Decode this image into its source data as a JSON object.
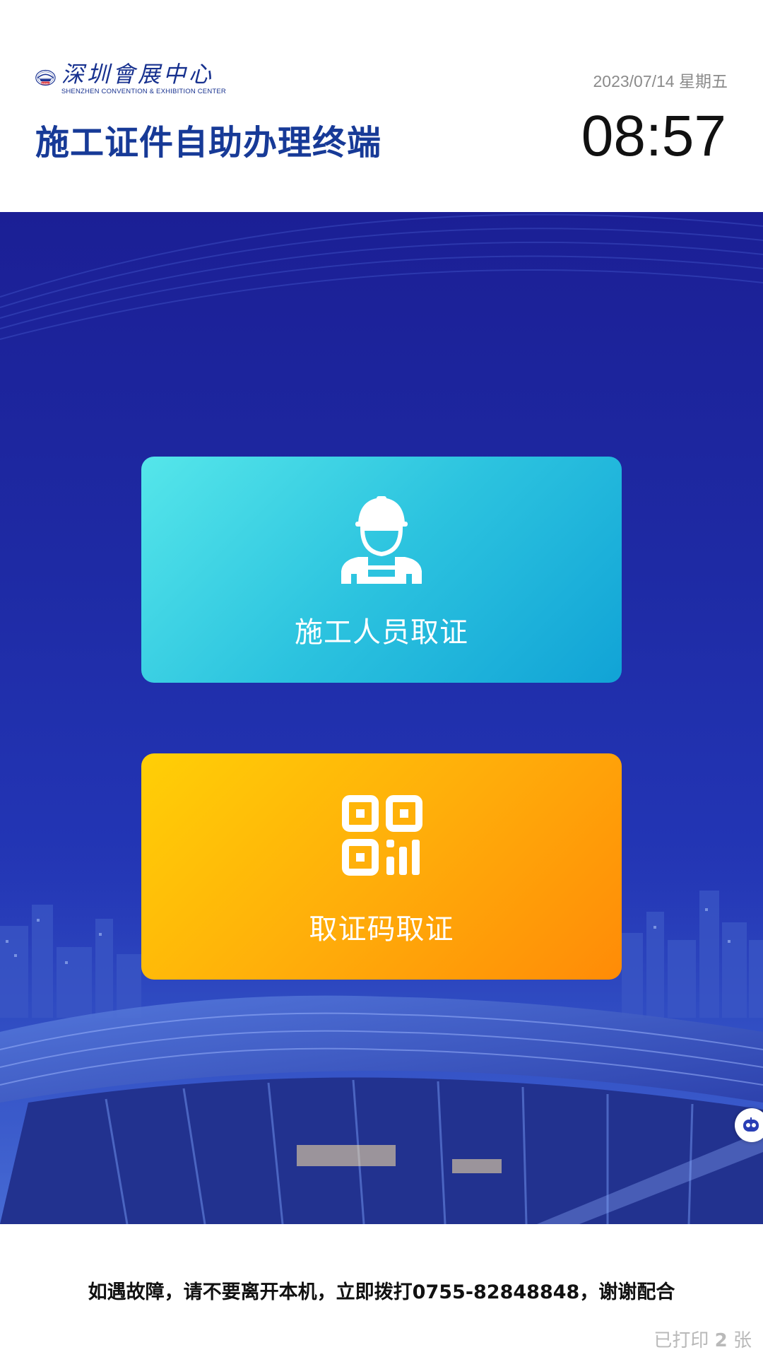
{
  "header": {
    "logo": {
      "org_name_cn": "深圳會展中心",
      "org_name_en": "SHENZHEN CONVENTION & EXHIBITION CENTER",
      "badge": "SZCEC"
    },
    "title": "施工证件自助办理终端",
    "date": "2023/07/14 星期五",
    "time": "08:57"
  },
  "actions": [
    {
      "id": "worker",
      "label": "施工人员取证",
      "icon": "construction-worker-icon",
      "color_from": "#55e6ea",
      "color_to": "#11a3d6"
    },
    {
      "id": "qrcode",
      "label": "取证码取证",
      "icon": "qr-code-icon",
      "color_from": "#ffcf06",
      "color_to": "#ff8b07"
    }
  ],
  "assistant_bubble": {
    "icon": "robot-assistant-icon"
  },
  "footer": {
    "notice": "如遇故障，请不要离开本机，立即拨打0755-82848848，谢谢配合",
    "printed_prefix": "已打印 ",
    "printed_count": "2",
    "printed_suffix": " 张"
  },
  "colors": {
    "title_blue": "#173a97",
    "panel_blue": "#1e2aa4"
  }
}
